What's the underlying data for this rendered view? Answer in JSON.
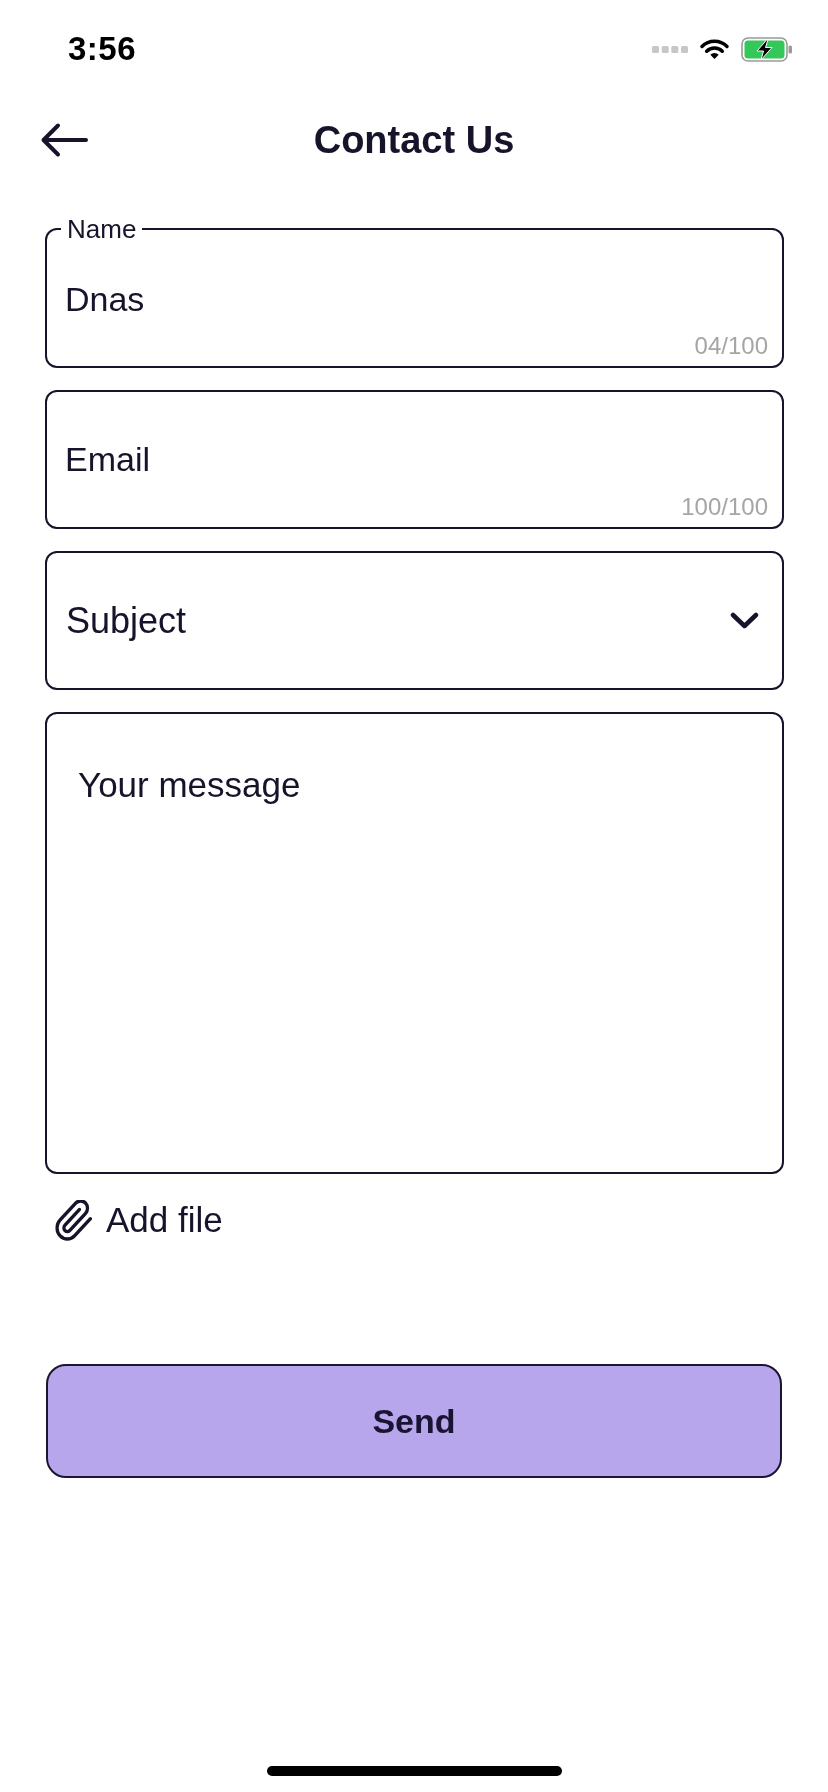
{
  "status_bar": {
    "time": "3:56"
  },
  "header": {
    "title": "Contact Us"
  },
  "form": {
    "fields": [
      {
        "kind": "text",
        "label": "Name",
        "value": "Dnas",
        "counter": "04/100"
      },
      {
        "kind": "text",
        "placeholder": "Email",
        "counter": "100/100"
      },
      {
        "kind": "dropdown",
        "placeholder": "Subject"
      },
      {
        "kind": "textarea",
        "placeholder": "Your message"
      }
    ],
    "attach": {
      "label": "Add file"
    },
    "submit": {
      "label": "Send"
    }
  }
}
